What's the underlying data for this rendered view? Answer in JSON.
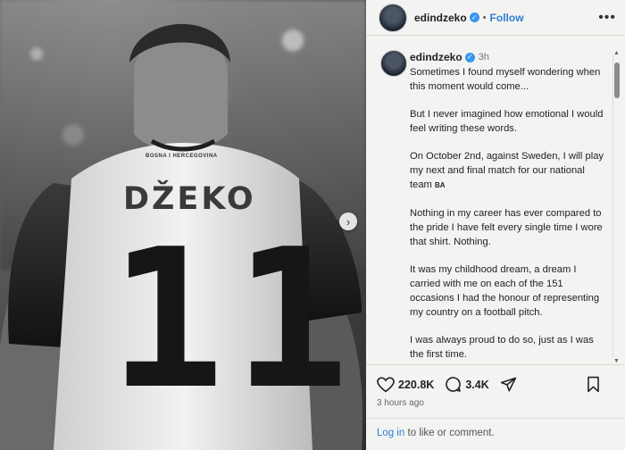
{
  "photo": {
    "jersey_header": "BOSNA I HERCEGOVINA",
    "jersey_name": "DŽEKO",
    "jersey_number": "11"
  },
  "post": {
    "username": "edindzeko",
    "follow_label": "Follow",
    "more_label": "•••",
    "caption_time": "3h",
    "caption": [
      "Sometimes I found myself wondering when this moment would come...",
      "But I never imagined how emotional I would feel writing these words.",
      "On October 2nd, against Sweden, I will play my next and final match for our national team",
      "Nothing in my career has ever compared to the pride I have felt every single time I wore that shirt. Nothing.",
      "It was my childhood dream, a dream I carried with me on each of the 151 occasions I had the honour of representing my country on a football pitch.",
      "I was always proud to do so, just as I was the first time."
    ],
    "flag_text": "BA",
    "likes": "220.8K",
    "comments": "3.4K",
    "posted_time": "3 hours ago",
    "login_link": "Log in",
    "login_rest": " to like or comment."
  },
  "icons": {
    "verified": "verified-badge-icon",
    "like": "heart-icon",
    "comment": "comment-bubble-icon",
    "share": "share-paper-plane-icon",
    "save": "bookmark-icon",
    "next": "chevron-right-icon"
  },
  "colors": {
    "accent": "#2d7fd4",
    "verified": "#3897f0",
    "panel": "#f3f3f1"
  }
}
